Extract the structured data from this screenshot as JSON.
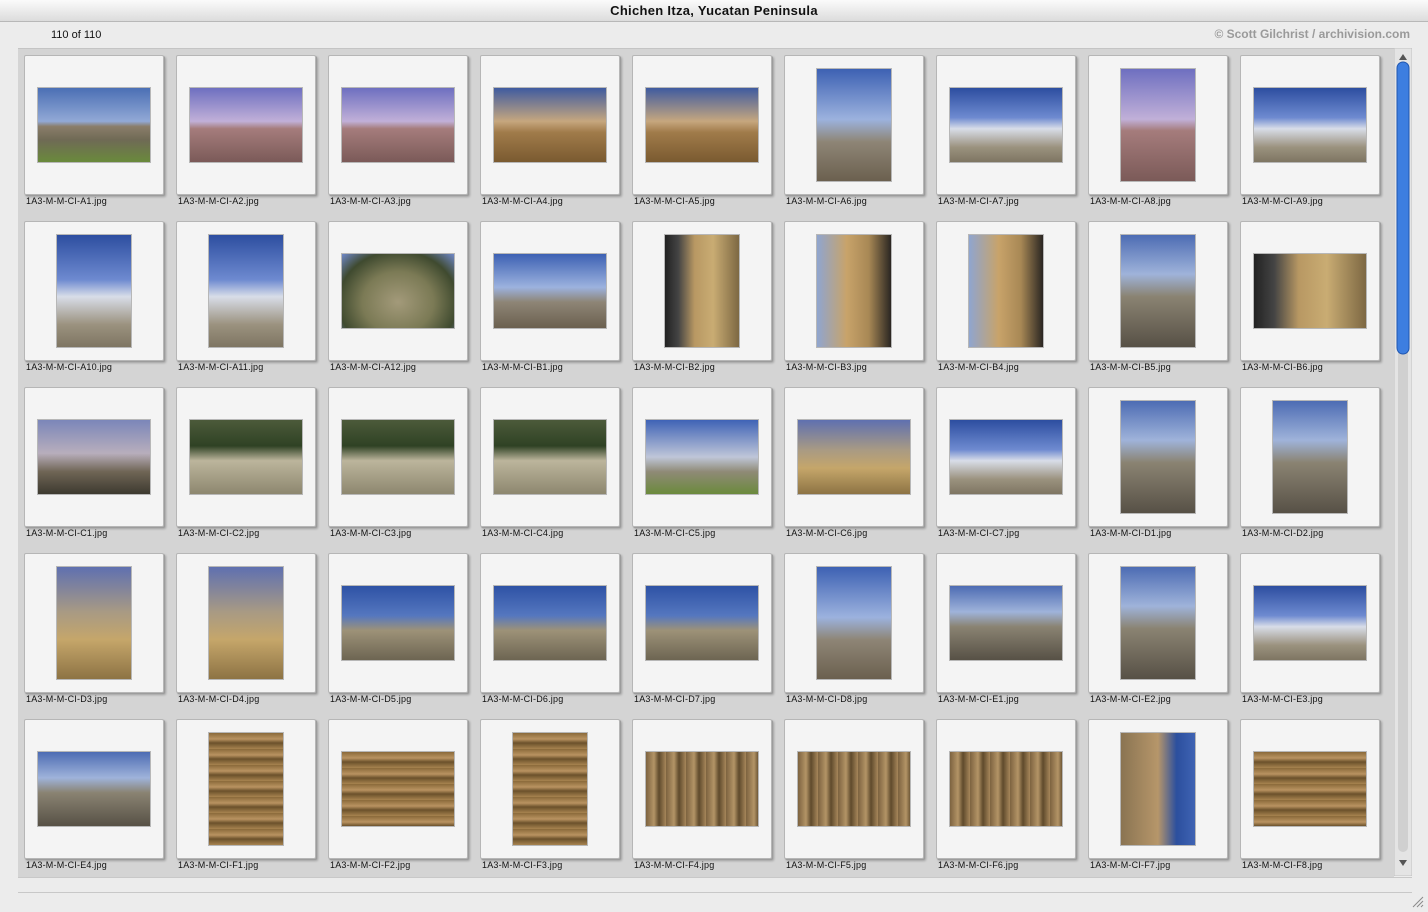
{
  "window": {
    "title": "Chichen Itza, Yucatan Peninsula"
  },
  "info": {
    "count_text": "110 of 110",
    "credit": "© Scott Gilchrist / archivision.com"
  },
  "colors": {
    "window_bg": "#ececec",
    "grid_bg": "#d4d4d4",
    "slide_bg": "#f4f4f4",
    "scroll_thumb": "#3d7ee0"
  },
  "thumbnails": [
    {
      "file": "1A3-M-M-CI-A1.jpg",
      "orientation": "h",
      "palette": "t-pyr-sky"
    },
    {
      "file": "1A3-M-M-CI-A2.jpg",
      "orientation": "h",
      "palette": "t-pyr-dusk"
    },
    {
      "file": "1A3-M-M-CI-A3.jpg",
      "orientation": "h",
      "palette": "t-pyr-dusk"
    },
    {
      "file": "1A3-M-M-CI-A4.jpg",
      "orientation": "h",
      "palette": "t-pyr-gold"
    },
    {
      "file": "1A3-M-M-CI-A5.jpg",
      "orientation": "h",
      "palette": "t-pyr-gold"
    },
    {
      "file": "1A3-M-M-CI-A6.jpg",
      "orientation": "v",
      "palette": "t-sky-stone"
    },
    {
      "file": "1A3-M-M-CI-A7.jpg",
      "orientation": "h",
      "palette": "t-blue-sky"
    },
    {
      "file": "1A3-M-M-CI-A8.jpg",
      "orientation": "v",
      "palette": "t-pyr-dusk"
    },
    {
      "file": "1A3-M-M-CI-A9.jpg",
      "orientation": "h",
      "palette": "t-blue-sky"
    },
    {
      "file": "1A3-M-M-CI-A10.jpg",
      "orientation": "v",
      "palette": "t-blue-sky"
    },
    {
      "file": "1A3-M-M-CI-A11.jpg",
      "orientation": "v",
      "palette": "t-blue-sky"
    },
    {
      "file": "1A3-M-M-CI-A12.jpg",
      "orientation": "h",
      "palette": "t-fisheye"
    },
    {
      "file": "1A3-M-M-CI-B1.jpg",
      "orientation": "h",
      "palette": "t-sky-stone"
    },
    {
      "file": "1A3-M-M-CI-B2.jpg",
      "orientation": "v",
      "palette": "t-arch"
    },
    {
      "file": "1A3-M-M-CI-B3.jpg",
      "orientation": "v",
      "palette": "t-arch2"
    },
    {
      "file": "1A3-M-M-CI-B4.jpg",
      "orientation": "v",
      "palette": "t-arch2"
    },
    {
      "file": "1A3-M-M-CI-B5.jpg",
      "orientation": "v",
      "palette": "t-colonnade"
    },
    {
      "file": "1A3-M-M-CI-B6.jpg",
      "orientation": "h",
      "palette": "t-arch"
    },
    {
      "file": "1A3-M-M-CI-C1.jpg",
      "orientation": "h",
      "palette": "t-dusk-flat"
    },
    {
      "file": "1A3-M-M-CI-C2.jpg",
      "orientation": "h",
      "palette": "t-jungle"
    },
    {
      "file": "1A3-M-M-CI-C3.jpg",
      "orientation": "h",
      "palette": "t-jungle"
    },
    {
      "file": "1A3-M-M-CI-C4.jpg",
      "orientation": "h",
      "palette": "t-jungle"
    },
    {
      "file": "1A3-M-M-CI-C5.jpg",
      "orientation": "h",
      "palette": "t-temple"
    },
    {
      "file": "1A3-M-M-CI-C6.jpg",
      "orientation": "h",
      "palette": "t-ruins-gold"
    },
    {
      "file": "1A3-M-M-CI-C7.jpg",
      "orientation": "h",
      "palette": "t-blue-sky"
    },
    {
      "file": "1A3-M-M-CI-D1.jpg",
      "orientation": "v",
      "palette": "t-colonnade"
    },
    {
      "file": "1A3-M-M-CI-D2.jpg",
      "orientation": "v",
      "palette": "t-colonnade"
    },
    {
      "file": "1A3-M-M-CI-D3.jpg",
      "orientation": "v",
      "palette": "t-ruins-gold"
    },
    {
      "file": "1A3-M-M-CI-D4.jpg",
      "orientation": "v",
      "palette": "t-ruins-gold"
    },
    {
      "file": "1A3-M-M-CI-D5.jpg",
      "orientation": "h",
      "palette": "t-ruins-blue"
    },
    {
      "file": "1A3-M-M-CI-D6.jpg",
      "orientation": "h",
      "palette": "t-ruins-blue"
    },
    {
      "file": "1A3-M-M-CI-D7.jpg",
      "orientation": "h",
      "palette": "t-ruins-blue"
    },
    {
      "file": "1A3-M-M-CI-D8.jpg",
      "orientation": "v",
      "palette": "t-sky-stone"
    },
    {
      "file": "1A3-M-M-CI-E1.jpg",
      "orientation": "h",
      "palette": "t-colonnade"
    },
    {
      "file": "1A3-M-M-CI-E2.jpg",
      "orientation": "v",
      "palette": "t-colonnade"
    },
    {
      "file": "1A3-M-M-CI-E3.jpg",
      "orientation": "h",
      "palette": "t-blue-sky"
    },
    {
      "file": "1A3-M-M-CI-E4.jpg",
      "orientation": "h",
      "palette": "t-colonnade"
    },
    {
      "file": "1A3-M-M-CI-F1.jpg",
      "orientation": "v",
      "palette": "t-carving"
    },
    {
      "file": "1A3-M-M-CI-F2.jpg",
      "orientation": "h",
      "palette": "t-carving"
    },
    {
      "file": "1A3-M-M-CI-F3.jpg",
      "orientation": "v",
      "palette": "t-carving"
    },
    {
      "file": "1A3-M-M-CI-F4.jpg",
      "orientation": "h",
      "palette": "t-carving2"
    },
    {
      "file": "1A3-M-M-CI-F5.jpg",
      "orientation": "h",
      "palette": "t-carving2"
    },
    {
      "file": "1A3-M-M-CI-F6.jpg",
      "orientation": "h",
      "palette": "t-carving2"
    },
    {
      "file": "1A3-M-M-CI-F7.jpg",
      "orientation": "v",
      "palette": "t-wall-sky"
    },
    {
      "file": "1A3-M-M-CI-F8.jpg",
      "orientation": "h",
      "palette": "t-carving"
    }
  ],
  "scrollbar": {
    "up_icon": "arrow-up-icon",
    "down_icon": "arrow-down-icon",
    "position_fraction": 0.0,
    "visible_fraction": 0.37
  }
}
